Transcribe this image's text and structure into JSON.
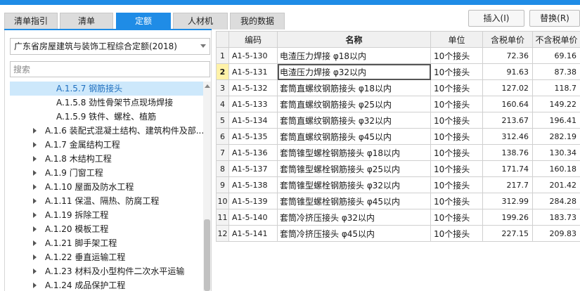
{
  "tabs": [
    {
      "label": "清单指引",
      "active": false
    },
    {
      "label": "清单",
      "active": false
    },
    {
      "label": "定额",
      "active": true
    },
    {
      "label": "人材机",
      "active": false
    },
    {
      "label": "我的数据",
      "active": false
    }
  ],
  "toolbar": {
    "insert_label": "插入(I)",
    "replace_label": "替换(R)"
  },
  "library": {
    "selected": "广东省房屋建筑与装饰工程综合定额(2018)"
  },
  "search": {
    "placeholder": "搜索"
  },
  "tree": [
    {
      "label": "A.1.5.7 钢筋接头",
      "expandable": false,
      "selected": true
    },
    {
      "label": "A.1.5.8 劲性骨架节点现场焊接",
      "expandable": false,
      "selected": false
    },
    {
      "label": "A.1.5.9 铁件、螺栓、植筋",
      "expandable": false,
      "selected": false
    },
    {
      "label": "A.1.6 装配式混凝土结构、建筑构件及部...",
      "expandable": true,
      "selected": false
    },
    {
      "label": "A.1.7 金属结构工程",
      "expandable": true,
      "selected": false
    },
    {
      "label": "A.1.8 木结构工程",
      "expandable": true,
      "selected": false
    },
    {
      "label": "A.1.9 门窗工程",
      "expandable": true,
      "selected": false
    },
    {
      "label": "A.1.10 屋面及防水工程",
      "expandable": true,
      "selected": false
    },
    {
      "label": "A.1.11 保温、隔热、防腐工程",
      "expandable": true,
      "selected": false
    },
    {
      "label": "A.1.19 拆除工程",
      "expandable": true,
      "selected": false
    },
    {
      "label": "A.1.20 模板工程",
      "expandable": true,
      "selected": false
    },
    {
      "label": "A.1.21 脚手架工程",
      "expandable": true,
      "selected": false
    },
    {
      "label": "A.1.22 垂直运输工程",
      "expandable": true,
      "selected": false
    },
    {
      "label": "A.1.23 材料及小型构件二次水平运输",
      "expandable": true,
      "selected": false
    },
    {
      "label": "A.1.24 成品保护工程",
      "expandable": true,
      "selected": false
    }
  ],
  "table": {
    "headers": [
      "",
      "编码",
      "名称",
      "单位",
      "含税单价",
      "不含税单价"
    ],
    "rows": [
      {
        "idx": "1",
        "code": "A1-5-130",
        "name": "电渣压力焊接 φ18以内",
        "unit": "10个接头",
        "price_tax": "72.36",
        "price_notax": "69.16"
      },
      {
        "idx": "2",
        "code": "A1-5-131",
        "name": "电渣压力焊接 φ32以内",
        "unit": "10个接头",
        "price_tax": "91.63",
        "price_notax": "87.38"
      },
      {
        "idx": "3",
        "code": "A1-5-132",
        "name": "套筒直螺纹钢筋接头 φ18以内",
        "unit": "10个接头",
        "price_tax": "127.02",
        "price_notax": "118.7"
      },
      {
        "idx": "4",
        "code": "A1-5-133",
        "name": "套筒直螺纹钢筋接头 φ25以内",
        "unit": "10个接头",
        "price_tax": "160.64",
        "price_notax": "149.22"
      },
      {
        "idx": "5",
        "code": "A1-5-134",
        "name": "套筒直螺纹钢筋接头 φ32以内",
        "unit": "10个接头",
        "price_tax": "213.67",
        "price_notax": "196.41"
      },
      {
        "idx": "6",
        "code": "A1-5-135",
        "name": "套筒直螺纹钢筋接头 φ45以内",
        "unit": "10个接头",
        "price_tax": "312.46",
        "price_notax": "282.19"
      },
      {
        "idx": "7",
        "code": "A1-5-136",
        "name": "套筒锥型螺栓钢筋接头 φ18以内",
        "unit": "10个接头",
        "price_tax": "138.76",
        "price_notax": "130.34"
      },
      {
        "idx": "8",
        "code": "A1-5-137",
        "name": "套筒锥型螺栓钢筋接头 φ25以内",
        "unit": "10个接头",
        "price_tax": "171.74",
        "price_notax": "160.18"
      },
      {
        "idx": "9",
        "code": "A1-5-138",
        "name": "套筒锥型螺栓钢筋接头 φ32以内",
        "unit": "10个接头",
        "price_tax": "217.7",
        "price_notax": "201.42"
      },
      {
        "idx": "10",
        "code": "A1-5-139",
        "name": "套筒锥型螺栓钢筋接头 φ45以内",
        "unit": "10个接头",
        "price_tax": "312.99",
        "price_notax": "284.28"
      },
      {
        "idx": "11",
        "code": "A1-5-140",
        "name": "套筒冷挤压接头 φ32以内",
        "unit": "10个接头",
        "price_tax": "199.26",
        "price_notax": "183.73"
      },
      {
        "idx": "12",
        "code": "A1-5-141",
        "name": "套筒冷挤压接头 φ45以内",
        "unit": "10个接头",
        "price_tax": "227.15",
        "price_notax": "209.83"
      }
    ]
  },
  "colors": {
    "accent": "#1f8ce6",
    "selected_row_bg": "#fff2a8",
    "tree_selected_bg": "#cde8fb"
  }
}
